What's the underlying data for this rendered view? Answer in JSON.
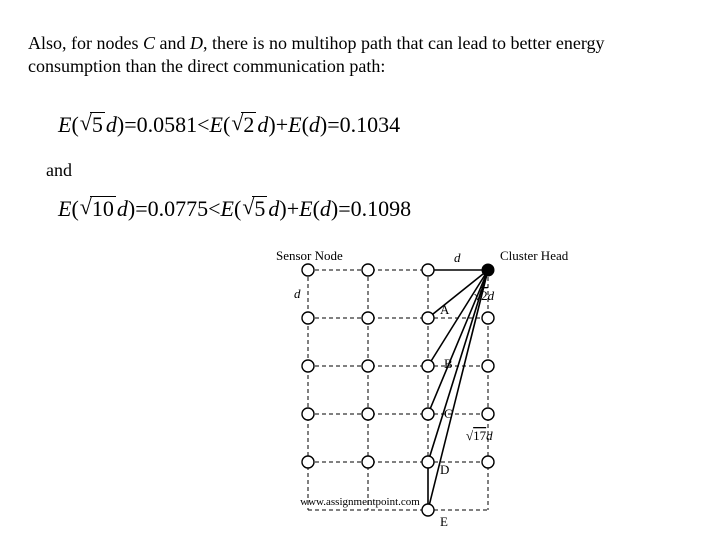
{
  "para1_a": "Also, for nodes ",
  "para1_b": " and ",
  "para1_c": ", there is no multihop path that can lead to better energy consumption than the direct communication path:",
  "para1_C": "C",
  "para1_D": "D",
  "eq1": {
    "E": "E",
    "lp": "(",
    "rp": ")",
    "s5": "5",
    "d": "d",
    "eq": " = ",
    "v1": "0.0581",
    "lt": " < ",
    "plus": " + ",
    "s2": "2",
    "v2": "0.1034"
  },
  "and": "and",
  "eq2": {
    "E": "E",
    "lp": "(",
    "rp": ")",
    "s10": "10",
    "d": "d",
    "eq": " = ",
    "v1": "0.0775",
    "lt": " < ",
    "plus": " + ",
    "s5": "5",
    "v2": "0.1098"
  },
  "fig": {
    "sensorNode": "Sensor Node",
    "clusterHead": "Cluster Head",
    "d_top": "d",
    "d_left": "d",
    "A": "A",
    "B": "B",
    "C": "C",
    "D": "D",
    "E": "E",
    "r2d": "√2d",
    "r17d": "√17d"
  },
  "footer": "www.assignmentpoint.com",
  "chart_data": {
    "type": "diagram",
    "description": "4x5 grid of sensor nodes spaced d apart; Cluster Head at top-right corner. Nodes in rightmost column labeled A-E from just below cluster head going down. Solid lines from cluster head to A,B,C,D,E show direct paths; dashed lines show grid/multihop. Distance labels: d between adjacent nodes, √2d from cluster head to A diagonal neighbor, √17d from cluster head to a farther node.",
    "grid": {
      "cols": 4,
      "rows": 5,
      "spacing": "d"
    },
    "cluster_head": {
      "row": 0,
      "col": 3
    },
    "labeled_nodes": [
      {
        "name": "A",
        "row": 1,
        "col": 3
      },
      {
        "name": "B",
        "row": 2,
        "col": 3
      },
      {
        "name": "C",
        "row": 3,
        "col": 3
      },
      {
        "name": "D",
        "row": 4,
        "col": 3
      },
      {
        "name": "E",
        "row": 5,
        "col": 3
      }
    ],
    "direct_path_distances": {
      "A": "d",
      "B": "√2 d",
      "C": "√5 d",
      "D": "√10 d",
      "E": "√17 d"
    },
    "energy_comparisons": [
      {
        "lhs": "E(√5 d)",
        "lhs_val": 0.0581,
        "op": "<",
        "rhs": "E(√2 d)+E(d)",
        "rhs_val": 0.1034
      },
      {
        "lhs": "E(√10 d)",
        "lhs_val": 0.0775,
        "op": "<",
        "rhs": "E(√5 d)+E(d)",
        "rhs_val": 0.1098
      }
    ]
  }
}
